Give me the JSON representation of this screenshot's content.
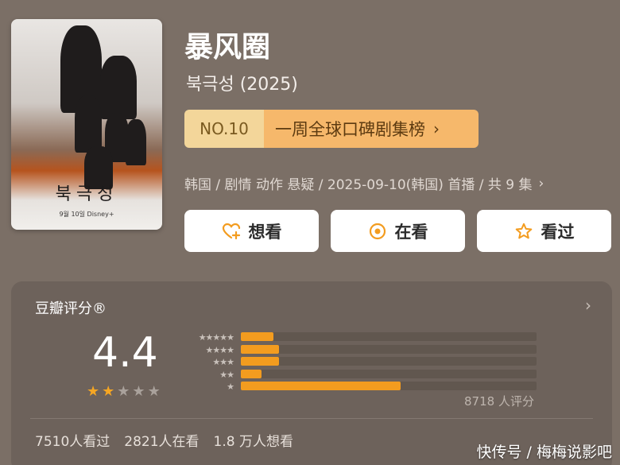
{
  "poster": {
    "title_ko": "북극성",
    "brand": "9월 10일  Disney+"
  },
  "title": "暴风圈",
  "subtitle": "북극성 (2025)",
  "rank": {
    "no": "NO.10",
    "label": "一周全球口碑剧集榜"
  },
  "meta": "韩国 / 剧情 动作 悬疑 / 2025-09-10(韩国) 首播 / 共 9 集",
  "actions": [
    {
      "label": "想看",
      "icon": "heart-plus-icon"
    },
    {
      "label": "在看",
      "icon": "target-icon"
    },
    {
      "label": "看过",
      "icon": "star-outline-icon"
    }
  ],
  "rating": {
    "title": "豆瓣评分®",
    "score": "4.4",
    "stars_filled": 2,
    "stars_total": 5,
    "distribution": [
      {
        "stars": 5,
        "label": "★★★★★",
        "fraction": 0.11
      },
      {
        "stars": 4,
        "label": "★★★★",
        "fraction": 0.13
      },
      {
        "stars": 3,
        "label": "★★★",
        "fraction": 0.13
      },
      {
        "stars": 2,
        "label": "★★",
        "fraction": 0.07
      },
      {
        "stars": 1,
        "label": "★",
        "fraction": 0.54
      }
    ],
    "count": "8718 人评分",
    "stats": {
      "watched": "7510人看过",
      "watching": "2821人在看",
      "want": "1.8 万人想看"
    }
  },
  "watermark": "快传号 / 梅梅说影吧",
  "colors": {
    "accent": "#f39c1f",
    "rank_left": "#f3d69a",
    "rank_right": "#f6b86b"
  }
}
